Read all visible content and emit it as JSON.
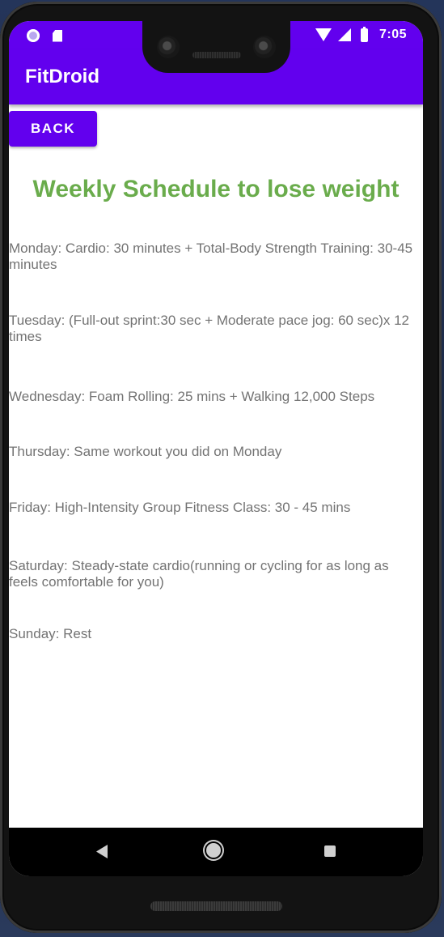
{
  "status_bar": {
    "time": "7:05",
    "left_icons": [
      "notification-circle-icon",
      "sd-card-icon"
    ],
    "right_icons": [
      "wifi-icon",
      "cell-signal-icon",
      "battery-icon"
    ]
  },
  "app_bar": {
    "title": "FitDroid"
  },
  "back_button": {
    "label": "BACK"
  },
  "page": {
    "title": "Weekly Schedule to lose weight"
  },
  "schedule": [
    " Monday: Cardio: 30 minutes + Total-Body Strength Training: 30-45 minutes",
    " Tuesday: (Full-out sprint:30 sec + Moderate pace jog: 60 sec)x 12 times",
    " Wednesday: Foam Rolling: 25 mins + Walking 12,000 Steps",
    " Thursday: Same workout you did on Monday",
    " Friday: High-Intensity Group Fitness Class: 30 - 45 mins",
    " Saturday: Steady-state cardio(running or cycling for as long as feels comfortable for you)",
    " Sunday: Rest"
  ],
  "nav_bar": {
    "icons": [
      "nav-back-icon",
      "nav-home-icon",
      "nav-recents-icon"
    ]
  },
  "colors": {
    "primary": "#6200ee",
    "title_green": "#6aac4c",
    "body_text": "#737373"
  }
}
